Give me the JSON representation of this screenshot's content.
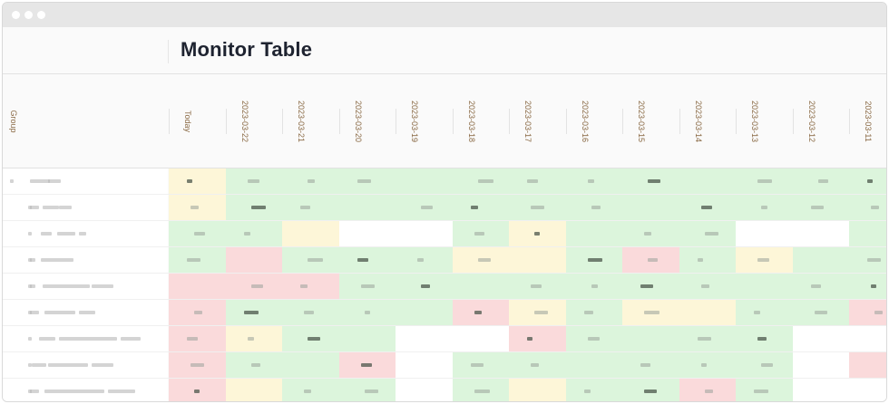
{
  "page": {
    "title": "Monitor Table"
  },
  "table": {
    "group_header": "Group",
    "columns": [
      "Today",
      "2023-03-22",
      "2023-03-21",
      "2023-03-20",
      "2023-03-19",
      "2023-03-18",
      "2023-03-17",
      "2023-03-16",
      "2023-03-15",
      "2023-03-14",
      "2023-03-13",
      "2023-03-12",
      "2023-03-11"
    ],
    "status_colors": {
      "ok": "#dcf5dc",
      "warning": "#fdf6d8",
      "error": "#fadadb",
      "no-data": "#ffffff"
    },
    "rows": [
      {
        "status": [
          "warning",
          "ok",
          "ok",
          "ok",
          "ok",
          "ok",
          "ok",
          "ok",
          "ok",
          "ok",
          "ok",
          "ok",
          "ok"
        ]
      },
      {
        "status": [
          "warning",
          "ok",
          "ok",
          "ok",
          "ok",
          "ok",
          "ok",
          "ok",
          "ok",
          "ok",
          "ok",
          "ok",
          "ok"
        ]
      },
      {
        "status": [
          "ok",
          "ok",
          "warning",
          "no-data",
          "no-data",
          "ok",
          "warning",
          "ok",
          "ok",
          "ok",
          "no-data",
          "no-data",
          "ok"
        ]
      },
      {
        "status": [
          "ok",
          "error",
          "ok",
          "ok",
          "ok",
          "warning",
          "warning",
          "ok",
          "error",
          "ok",
          "warning",
          "ok",
          "ok"
        ]
      },
      {
        "status": [
          "error",
          "error",
          "error",
          "ok",
          "ok",
          "ok",
          "ok",
          "ok",
          "ok",
          "ok",
          "ok",
          "ok",
          "ok"
        ]
      },
      {
        "status": [
          "error",
          "ok",
          "ok",
          "ok",
          "ok",
          "error",
          "warning",
          "ok",
          "warning",
          "warning",
          "ok",
          "ok",
          "error"
        ]
      },
      {
        "status": [
          "error",
          "warning",
          "ok",
          "ok",
          "no-data",
          "no-data",
          "error",
          "ok",
          "ok",
          "ok",
          "ok",
          "no-data",
          "no-data"
        ]
      },
      {
        "status": [
          "error",
          "ok",
          "ok",
          "error",
          "no-data",
          "ok",
          "ok",
          "ok",
          "ok",
          "ok",
          "ok",
          "no-data",
          "error"
        ]
      },
      {
        "status": [
          "error",
          "warning",
          "ok",
          "ok",
          "no-data",
          "ok",
          "warning",
          "ok",
          "ok",
          "error",
          "ok",
          "no-data",
          "no-data"
        ]
      }
    ]
  }
}
